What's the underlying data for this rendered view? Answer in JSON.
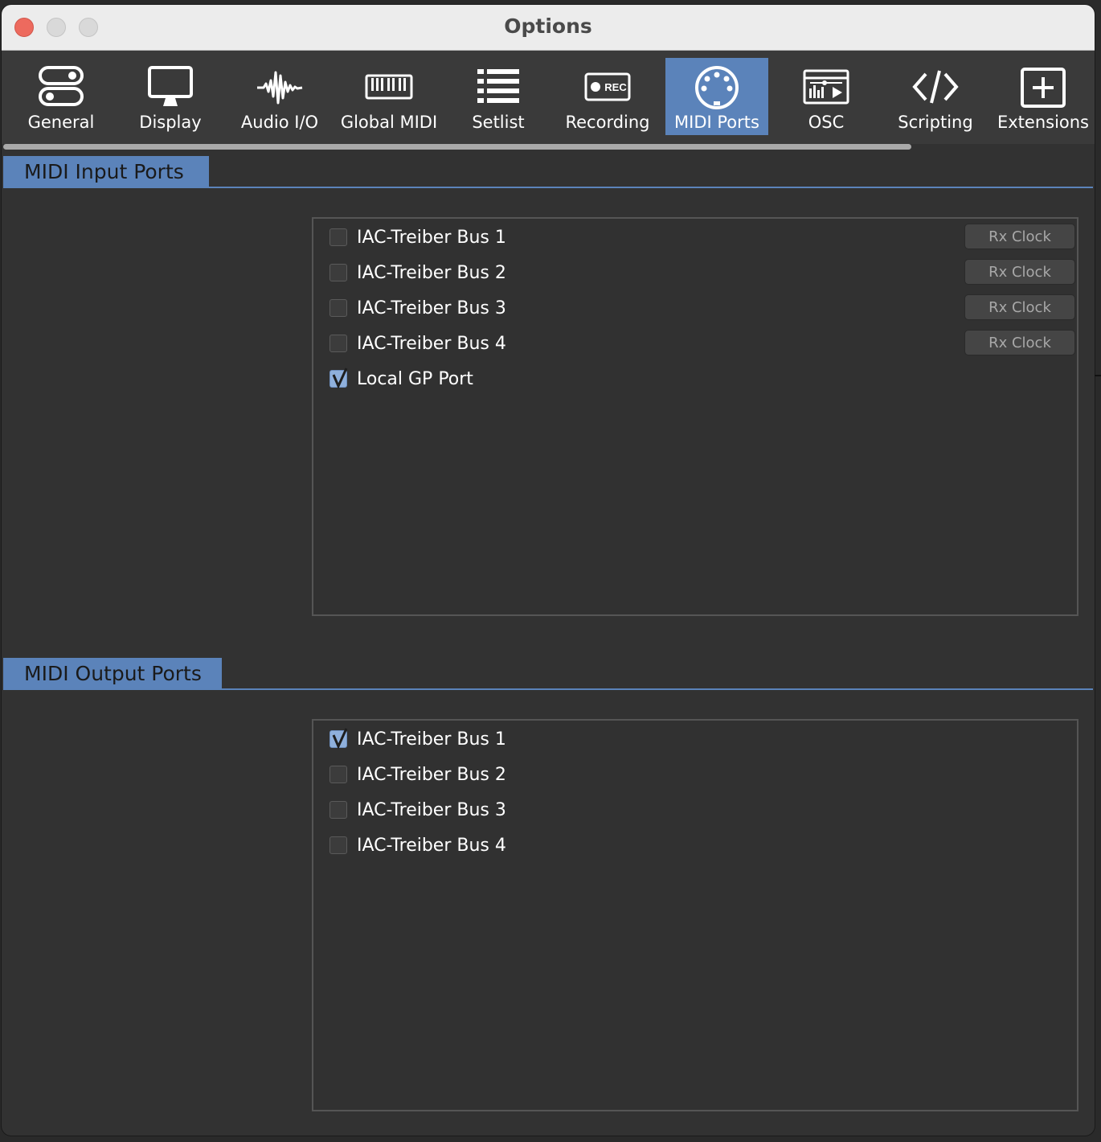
{
  "window": {
    "title": "Options"
  },
  "toolbar": {
    "items": [
      {
        "label": "General",
        "icon": "toggles-icon"
      },
      {
        "label": "Display",
        "icon": "monitor-icon"
      },
      {
        "label": "Audio I/O",
        "icon": "waveform-icon"
      },
      {
        "label": "Global MIDI",
        "icon": "keyboard-icon"
      },
      {
        "label": "Setlist",
        "icon": "list-icon"
      },
      {
        "label": "Recording",
        "icon": "rec-icon",
        "icon_text": "REC"
      },
      {
        "label": "MIDI Ports",
        "icon": "midi-din-icon",
        "active": true
      },
      {
        "label": "OSC",
        "icon": "osc-window-icon"
      },
      {
        "label": "Scripting",
        "icon": "code-icon"
      },
      {
        "label": "Extensions",
        "icon": "plus-box-icon"
      }
    ],
    "active_color": "#5b83ba"
  },
  "input_ports": {
    "section_title": "MIDI Input Ports",
    "rx_clock_label": "Rx Clock",
    "ports": [
      {
        "name": "IAC-Treiber Bus 1",
        "checked": false,
        "rx_clock": true
      },
      {
        "name": "IAC-Treiber Bus 2",
        "checked": false,
        "rx_clock": true
      },
      {
        "name": "IAC-Treiber Bus 3",
        "checked": false,
        "rx_clock": true
      },
      {
        "name": "IAC-Treiber Bus 4",
        "checked": false,
        "rx_clock": true
      },
      {
        "name": "Local GP Port",
        "checked": true,
        "rx_clock": false
      }
    ]
  },
  "output_ports": {
    "section_title": "MIDI Output Ports",
    "ports": [
      {
        "name": "IAC-Treiber Bus 1",
        "checked": true
      },
      {
        "name": "IAC-Treiber Bus 2",
        "checked": false
      },
      {
        "name": "IAC-Treiber Bus 3",
        "checked": false
      },
      {
        "name": "IAC-Treiber Bus 4",
        "checked": false
      }
    ]
  }
}
